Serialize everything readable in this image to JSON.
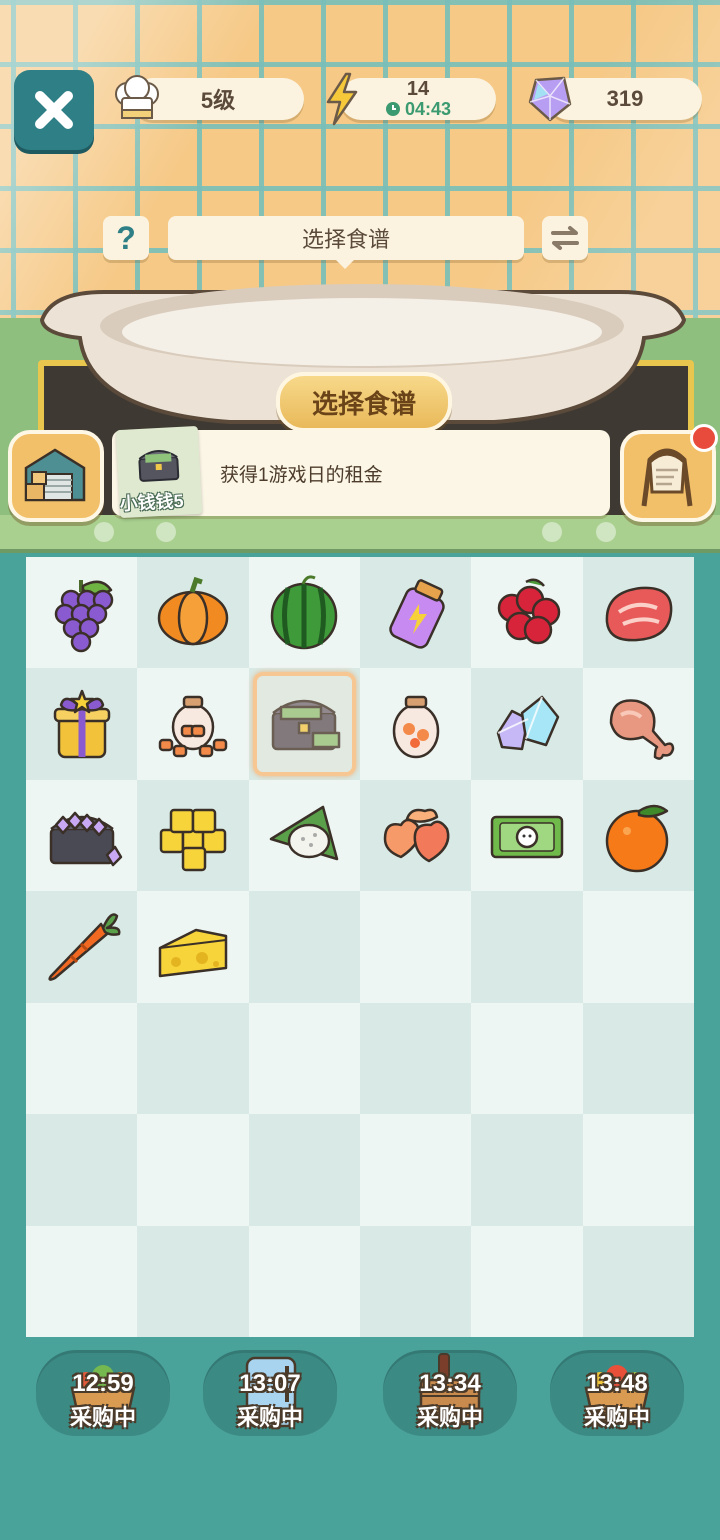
{
  "hud": {
    "level": "5级",
    "energy": "14",
    "energy_timer": "04:43",
    "gems": "319"
  },
  "recipe": {
    "header_label": "选择食谱",
    "help_label": "?",
    "button_label": "选择食谱"
  },
  "info": {
    "thumb_label": "小钱钱5",
    "text": "获得1游戏日的租金"
  },
  "board": {
    "rows": 7,
    "cols": 6,
    "items": [
      "grapes-icon",
      "pumpkin-icon",
      "watermelon-icon",
      "energy-jar-icon",
      "cranberries-icon",
      "steak-icon",
      "gift-box-icon",
      "candy-jar-pile-icon",
      "money-chest-icon",
      "candy-jar-icon",
      "crystals-icon",
      "chicken-leg-icon",
      "gem-chest-icon",
      "butter-cubes-icon",
      "rice-dumpling-icon",
      "heart-candies-icon",
      "banknote-icon",
      "orange-icon",
      "carrot-icon",
      "cheese-icon"
    ],
    "selected_index": 8
  },
  "timers": [
    {
      "time": "12:59",
      "status": "采购中",
      "icon": "vegetable-basket-icon"
    },
    {
      "time": "13:07",
      "status": "采购中",
      "icon": "fridge-icon"
    },
    {
      "time": "13:34",
      "status": "采购中",
      "icon": "drink-crate-icon"
    },
    {
      "time": "13:48",
      "status": "采购中",
      "icon": "fruit-basket-icon"
    }
  ]
}
